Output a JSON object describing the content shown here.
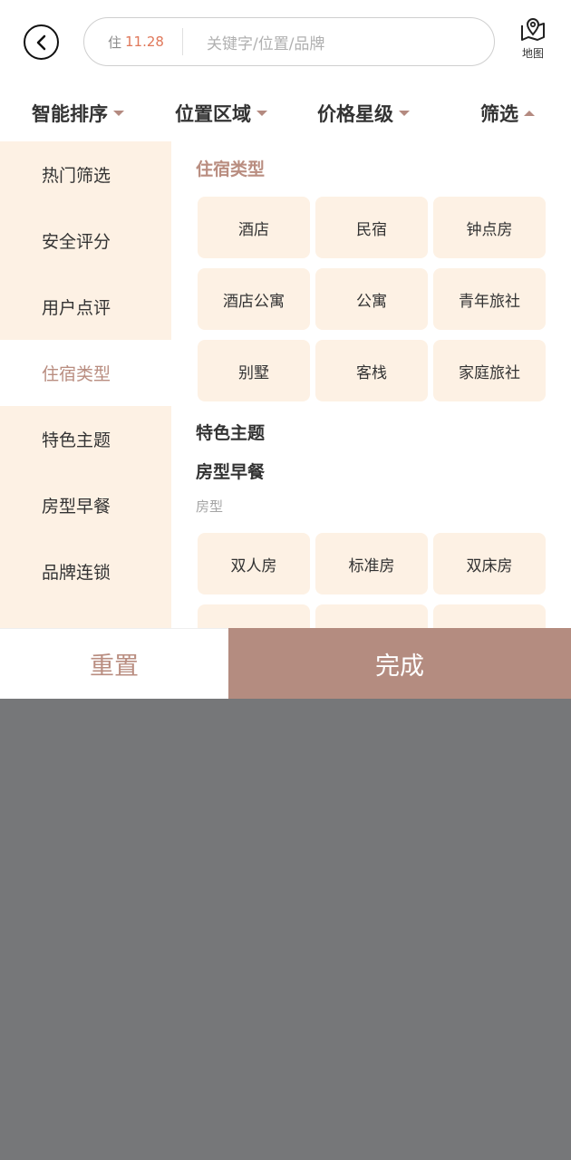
{
  "header": {
    "stay_label": "住",
    "stay_date": "11.28",
    "search_placeholder": "关键字/位置/品牌",
    "map_label": "地图"
  },
  "sortbar": {
    "items": [
      "智能排序",
      "位置区域",
      "价格星级",
      "筛选"
    ]
  },
  "sidemenu": {
    "items": [
      "热门筛选",
      "安全评分",
      "用户点评",
      "住宿类型",
      "特色主题",
      "房型早餐",
      "品牌连锁"
    ],
    "active": "住宿类型"
  },
  "content": {
    "lodging_title": "住宿类型",
    "lodging_options": [
      "酒店",
      "民宿",
      "钟点房",
      "酒店公寓",
      "公寓",
      "青年旅社",
      "别墅",
      "客栈",
      "家庭旅社"
    ],
    "theme_title": "特色主题",
    "room_breakfast_title": "房型早餐",
    "room_subtitle": "房型",
    "room_options": [
      "双人房",
      "标准房",
      "双床房"
    ]
  },
  "footer": {
    "reset_label": "重置",
    "done_label": "完成"
  },
  "colors": {
    "accent": "#b48c80",
    "chip_bg": "#fdf1e4",
    "date": "#e0785a",
    "overlay": "#767779"
  }
}
